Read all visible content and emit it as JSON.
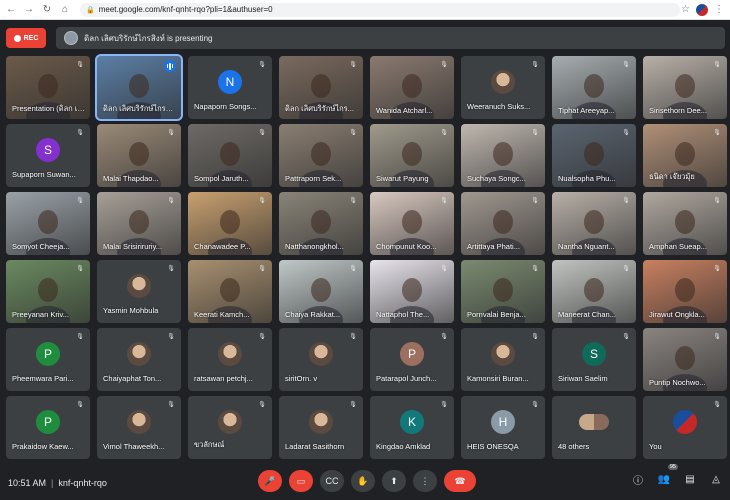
{
  "browser": {
    "url": "meet.google.com/knf-qnht-rqo?pli=1&authuser=0"
  },
  "meeting": {
    "rec_label": "REC",
    "presenting_text": "ดิลก เลิศบริรักษ์ไกรสิงห์ is presenting",
    "time": "10:51 AM",
    "code": "knf-qnht-rqo",
    "participants_count": "95",
    "others_label": "48 others",
    "you_label": "You"
  },
  "colors": {
    "green": "#1e8e3e",
    "blue": "#1a73e8",
    "teal": "#12797a",
    "purple": "#8430ce",
    "rose": "#9c6f5f",
    "dark_teal": "#0f6a5a"
  },
  "tiles": [
    {
      "name": "Presentation (ดิลก เลิศบริรักษ์ไกรสิงห์)",
      "type": "video",
      "bg": "#6b5a4a"
    },
    {
      "name": "ดิลก เลิศบริรักษ์ไกรสิงห์",
      "type": "video",
      "bg": "#5b7fa6",
      "active": true
    },
    {
      "name": "Napaporn Songs...",
      "type": "avatar",
      "letter": "N",
      "color": "#1a73e8"
    },
    {
      "name": "ดิลก เลิศบริรักษ์ไกร...",
      "type": "video",
      "bg": "#7a6a5e"
    },
    {
      "name": "Wanida Atcharl...",
      "type": "video",
      "bg": "#8a7a70"
    },
    {
      "name": "Weeranuch Suks...",
      "type": "photo",
      "bg": "#4a4a4a"
    },
    {
      "name": "Tiphat Areeyap...",
      "type": "video",
      "bg": "#a6adb0"
    },
    {
      "name": "Sirisethorn Dee...",
      "type": "video",
      "bg": "#b8b0a8"
    },
    {
      "name": "Supaporn Suwan...",
      "type": "avatar",
      "letter": "S",
      "color": "#8430ce"
    },
    {
      "name": "Malai Thapdao...",
      "type": "video",
      "bg": "#9a8a78"
    },
    {
      "name": "Sompol Jaruth...",
      "type": "video",
      "bg": "#6e6a66"
    },
    {
      "name": "Pattraporn Sek...",
      "type": "video",
      "bg": "#8a7e72"
    },
    {
      "name": "Siwarut Payung",
      "type": "video",
      "bg": "#a09a8c"
    },
    {
      "name": "Suchaya Songc...",
      "type": "video",
      "bg": "#c0b8b0"
    },
    {
      "name": "Nualsopha Phu...",
      "type": "video",
      "bg": "#5a6470"
    },
    {
      "name": "ธนิดา เจ๊ยวมุ้ย",
      "type": "video",
      "bg": "#b09078"
    },
    {
      "name": "Somyot Cheeja...",
      "type": "video",
      "bg": "#9aa2a8"
    },
    {
      "name": "Malai Srisiriruriy...",
      "type": "video",
      "bg": "#a8a098"
    },
    {
      "name": "Chanawadee P...",
      "type": "video",
      "bg": "#c8a070"
    },
    {
      "name": "Natthanongkhol...",
      "type": "video",
      "bg": "#8a8478"
    },
    {
      "name": "Chompunut Koo...",
      "type": "video",
      "bg": "#d8c8c0"
    },
    {
      "name": "Artittaya Phati...",
      "type": "video",
      "bg": "#a09890"
    },
    {
      "name": "Nantha Nguant...",
      "type": "video",
      "bg": "#b8b0a8"
    },
    {
      "name": "Amphan Sueap...",
      "type": "video",
      "bg": "#b0a8a0"
    },
    {
      "name": "Preeyanan Kriv...",
      "type": "video",
      "bg": "#6a8a60"
    },
    {
      "name": "Yasmin Mohbula",
      "type": "photo",
      "bg": "#3c4043"
    },
    {
      "name": "Keerati Kamch...",
      "type": "video",
      "bg": "#a89070"
    },
    {
      "name": "Chaiya Rakkat...",
      "type": "video",
      "bg": "#c0c8c8"
    },
    {
      "name": "Nattaphol The...",
      "type": "video",
      "bg": "#e8e4ec"
    },
    {
      "name": "Pornvalai Benja...",
      "type": "video",
      "bg": "#7a8a70"
    },
    {
      "name": "Maneerat Chan...",
      "type": "video",
      "bg": "#c0c4c0"
    },
    {
      "name": "Jirawut Ongkla...",
      "type": "video",
      "bg": "#c88060"
    },
    {
      "name": "Pheemwara Pari...",
      "type": "avatar",
      "letter": "P",
      "color": "#1e8e3e"
    },
    {
      "name": "Chaiyaphat Ton...",
      "type": "photo",
      "bg": "#3c4043"
    },
    {
      "name": "ratsawan petchj...",
      "type": "photo",
      "bg": "#3c4043"
    },
    {
      "name": "siritOrn. v",
      "type": "photo",
      "bg": "#3c4043"
    },
    {
      "name": "Patarapol Junch...",
      "type": "avatar",
      "letter": "P",
      "color": "#9c6f5f"
    },
    {
      "name": "Kamonsiri Buran...",
      "type": "photo",
      "bg": "#3c4043"
    },
    {
      "name": "Siriwan Saelim",
      "type": "avatar",
      "letter": "S",
      "color": "#0f6a5a"
    },
    {
      "name": "Puntip Nochwo...",
      "type": "video",
      "bg": "#8a8480"
    },
    {
      "name": "Prakaidow Kaew...",
      "type": "avatar",
      "letter": "P",
      "color": "#1e8e3e"
    },
    {
      "name": "Vimol Thaweekh...",
      "type": "photo",
      "bg": "#3c4043"
    },
    {
      "name": "ขวลักษณ์",
      "type": "photo",
      "bg": "#3c4043"
    },
    {
      "name": "Ladarat Sasithorn",
      "type": "photo",
      "bg": "#3c4043"
    },
    {
      "name": "Kingdao Amklad",
      "type": "avatar",
      "letter": "K",
      "color": "#12797a"
    },
    {
      "name": "HEIS ONESQA",
      "type": "avatar",
      "letter": "H",
      "color": "#8a9aa6"
    },
    {
      "name": "48 others",
      "type": "others",
      "bg": "#3c4043"
    },
    {
      "name": "You",
      "type": "you",
      "bg": "#3c4043"
    }
  ]
}
